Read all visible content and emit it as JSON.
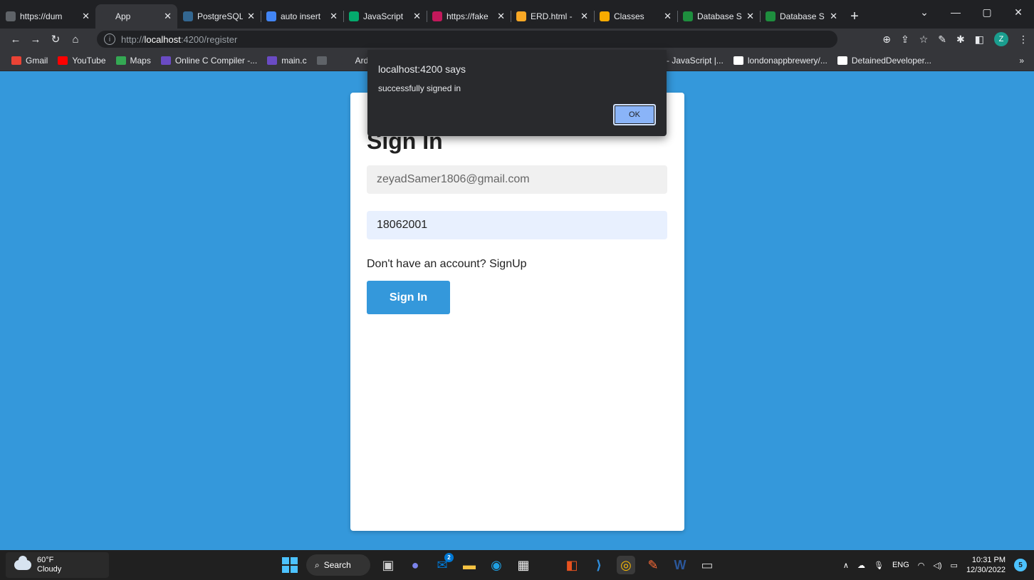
{
  "browser": {
    "tabs": [
      {
        "title": "https://dum",
        "icon": "globe-icon",
        "color": "#5f6368"
      },
      {
        "title": "App",
        "icon": "angular-icon",
        "color": "#35363a",
        "active": true
      },
      {
        "title": "PostgreSQL",
        "icon": "postgres-icon",
        "color": "#336791"
      },
      {
        "title": "auto insert",
        "icon": "google-icon",
        "color": "#4285f4"
      },
      {
        "title": "JavaScript",
        "icon": "w3-icon",
        "color": "#04aa6d"
      },
      {
        "title": "https://fake",
        "icon": "fake-icon",
        "color": "#c2185b"
      },
      {
        "title": "ERD.html -",
        "icon": "erd-icon",
        "color": "#f9a825"
      },
      {
        "title": "Classes",
        "icon": "classroom-icon",
        "color": "#f9ab00"
      },
      {
        "title": "Database S",
        "icon": "classroom-icon",
        "color": "#1e8e3e"
      },
      {
        "title": "Database S",
        "icon": "classroom-icon",
        "color": "#1e8e3e"
      }
    ],
    "url": {
      "proto": "http://",
      "host": "localhost",
      "path": ":4200/register"
    },
    "profile_initial": "Z",
    "bookmarks_left": [
      {
        "label": "Gmail",
        "icon": "gmail-icon",
        "color": "#ea4335"
      },
      {
        "label": "YouTube",
        "icon": "youtube-icon",
        "color": "#ff0000"
      },
      {
        "label": "Maps",
        "icon": "maps-icon",
        "color": "#34a853"
      },
      {
        "label": "Online C Compiler -...",
        "icon": "bolt-icon",
        "color": "#6a4bc4"
      },
      {
        "label": "main.c",
        "icon": "bolt-icon",
        "color": "#6a4bc4"
      },
      {
        "label": "",
        "icon": "globe-icon",
        "color": "#5f6368"
      },
      {
        "label": "Ard",
        "icon": "infinity-icon",
        "color": "#35363a"
      }
    ],
    "bookmarks_right": [
      {
        "label": "ay - JavaScript |...",
        "icon": "",
        "color": ""
      },
      {
        "label": "londonappbrewery/...",
        "icon": "github-icon",
        "color": "#ffffff"
      },
      {
        "label": "DetainedDeveloper...",
        "icon": "github-icon",
        "color": "#ffffff"
      }
    ],
    "more": "»"
  },
  "alert": {
    "title": "localhost:4200 says",
    "message": "successfully signed in",
    "ok_label": "OK"
  },
  "signin": {
    "heading": "Sign In",
    "email_value": "zeyadSamer1806@gmail.com",
    "password_value": "18062001",
    "signup_text": "Don't have an account? SignUp",
    "button_label": "Sign In"
  },
  "taskbar": {
    "weather_temp": "60°F",
    "weather_desc": "Cloudy",
    "search_label": "Search",
    "apps": [
      {
        "name": "task-view-icon",
        "glyph": "▣",
        "color": "#cfcfcf"
      },
      {
        "name": "teams-chat-icon",
        "glyph": "●",
        "color": "#7b83eb"
      },
      {
        "name": "mail-icon",
        "glyph": "✉",
        "color": "#0078d4",
        "badge": "2"
      },
      {
        "name": "file-explorer-icon",
        "glyph": "▬",
        "color": "#f6c342"
      },
      {
        "name": "edge-icon",
        "glyph": "◉",
        "color": "#1fa0e3"
      },
      {
        "name": "store-icon",
        "glyph": "▦",
        "color": "#f0f0f0"
      },
      {
        "name": "office-icon",
        "glyph": "◧",
        "color": "#e8521f"
      },
      {
        "name": "vscode-icon",
        "glyph": "⟩",
        "color": "#2f8fde"
      },
      {
        "name": "chrome-icon",
        "glyph": "◎",
        "color": "#fbbc05",
        "selected": true
      },
      {
        "name": "postman-icon",
        "glyph": "✎",
        "color": "#ff6c37"
      },
      {
        "name": "word-icon",
        "glyph": "W",
        "color": "#2b579a"
      },
      {
        "name": "terminal-icon",
        "glyph": "▭",
        "color": "#cccccc"
      }
    ],
    "lang": "ENG",
    "time": "10:31 PM",
    "date": "12/30/2022",
    "notifications": "5"
  }
}
